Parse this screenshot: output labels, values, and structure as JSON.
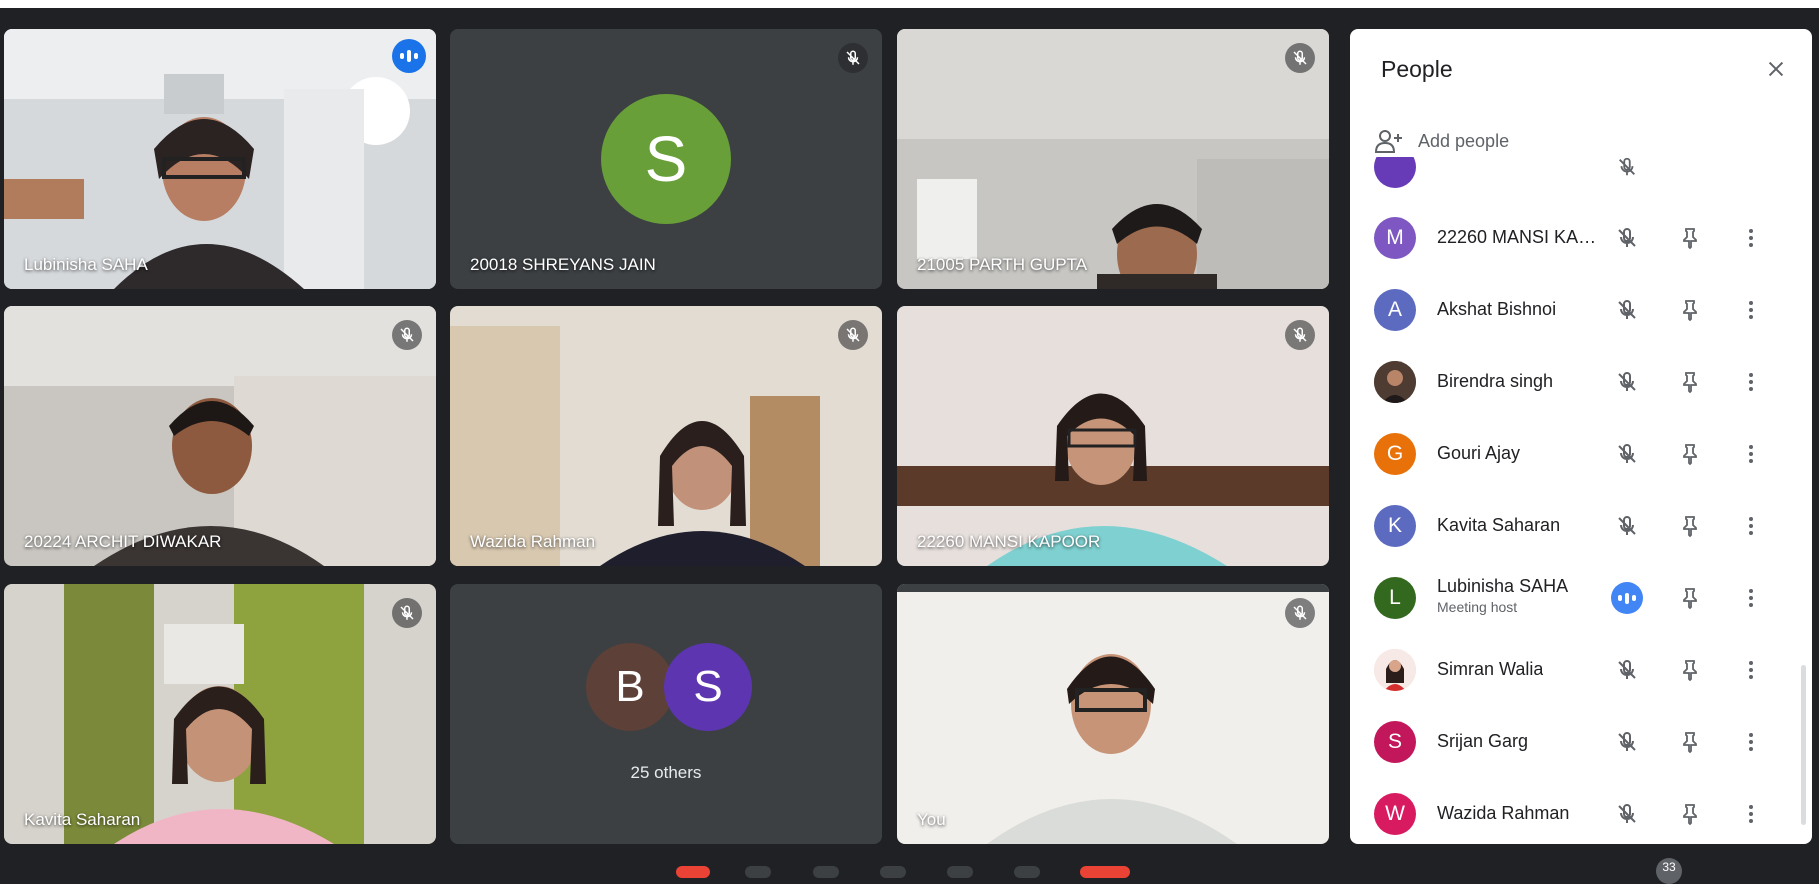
{
  "tiles": [
    {
      "name": "Lubinisha SAHA",
      "speaking": true
    },
    {
      "name": "20018 SHREYANS JAIN",
      "initial": "S",
      "avatar_color": "#689f38"
    },
    {
      "name": "21005 PARTH GUPTA"
    },
    {
      "name": "20224 ARCHIT DIWAKAR"
    },
    {
      "name": "Wazida Rahman"
    },
    {
      "name": "22260 MANSI KAPOOR"
    },
    {
      "name": "Kavita Saharan"
    },
    {
      "others_label": "25 others",
      "avatars": [
        {
          "initial": "B",
          "color": "#5d4037"
        },
        {
          "initial": "S",
          "color": "#5e35b1"
        }
      ]
    },
    {
      "name": "You"
    }
  ],
  "panel": {
    "title": "People",
    "add_people": "Add people",
    "participants": [
      {
        "name": "22260 MANSI KAP…",
        "initial": "M",
        "color": "#7e57c2"
      },
      {
        "name": "Akshat Bishnoi",
        "initial": "A",
        "color": "#5c6bc0"
      },
      {
        "name": "Birendra singh",
        "photo": true,
        "color": "#6d4c41"
      },
      {
        "name": "Gouri Ajay",
        "initial": "G",
        "color": "#e8710a"
      },
      {
        "name": "Kavita Saharan",
        "initial": "K",
        "color": "#5c6bc0"
      },
      {
        "name": "Lubinisha SAHA",
        "subtitle": "Meeting host",
        "initial": "L",
        "color": "#33691e",
        "speaking": true
      },
      {
        "name": "Simran Walia",
        "photo": true,
        "color": "#f3d2c9"
      },
      {
        "name": "Srijan Garg",
        "initial": "S",
        "color": "#c2185b"
      },
      {
        "name": "Wazida Rahman",
        "initial": "W",
        "color": "#d81b60"
      }
    ]
  },
  "controls": {
    "participant_count": "33"
  },
  "colors": {
    "accent": "#1a73e8",
    "speaking_ring": "#8ab4f8",
    "background": "#202124"
  }
}
